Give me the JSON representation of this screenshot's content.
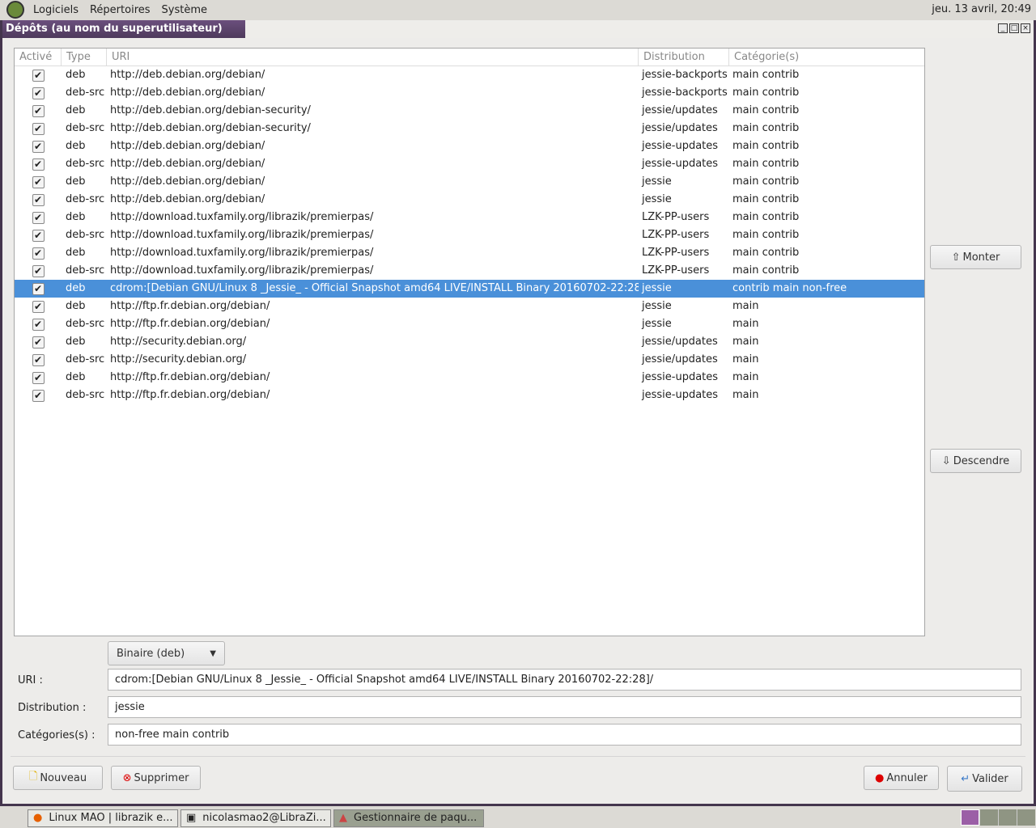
{
  "topbar": {
    "menus": [
      "Logiciels",
      "Répertoires",
      "Système"
    ],
    "clock": "jeu. 13 avril, 20:49"
  },
  "window": {
    "title": "Dépôts (au nom du superutilisateur)"
  },
  "table": {
    "headers": [
      "Activé",
      "Type",
      "URI",
      "Distribution",
      "Catégorie(s)"
    ],
    "rows": [
      [
        "deb",
        "http://deb.debian.org/debian/",
        "jessie-backports",
        "main contrib"
      ],
      [
        "deb-src",
        "http://deb.debian.org/debian/",
        "jessie-backports",
        "main contrib"
      ],
      [
        "deb",
        "http://deb.debian.org/debian-security/",
        "jessie/updates",
        "main contrib"
      ],
      [
        "deb-src",
        "http://deb.debian.org/debian-security/",
        "jessie/updates",
        "main contrib"
      ],
      [
        "deb",
        "http://deb.debian.org/debian/",
        "jessie-updates",
        "main contrib"
      ],
      [
        "deb-src",
        "http://deb.debian.org/debian/",
        "jessie-updates",
        "main contrib"
      ],
      [
        "deb",
        "http://deb.debian.org/debian/",
        "jessie",
        "main contrib"
      ],
      [
        "deb-src",
        "http://deb.debian.org/debian/",
        "jessie",
        "main contrib"
      ],
      [
        "deb",
        "http://download.tuxfamily.org/librazik/premierpas/",
        "LZK-PP-users",
        "main contrib"
      ],
      [
        "deb-src",
        "http://download.tuxfamily.org/librazik/premierpas/",
        "LZK-PP-users",
        "main contrib"
      ],
      [
        "deb",
        "http://download.tuxfamily.org/librazik/premierpas/",
        "LZK-PP-users",
        "main contrib"
      ],
      [
        "deb-src",
        "http://download.tuxfamily.org/librazik/premierpas/",
        "LZK-PP-users",
        "main contrib"
      ],
      [
        "deb",
        "cdrom:[Debian GNU/Linux 8 _Jessie_ - Official Snapshot amd64 LIVE/INSTALL Binary 20160702-22:28]/",
        "jessie",
        "contrib main non-free"
      ],
      [
        "deb",
        "http://ftp.fr.debian.org/debian/",
        "jessie",
        "main"
      ],
      [
        "deb-src",
        "http://ftp.fr.debian.org/debian/",
        "jessie",
        "main"
      ],
      [
        "deb",
        "http://security.debian.org/",
        "jessie/updates",
        "main"
      ],
      [
        "deb-src",
        "http://security.debian.org/",
        "jessie/updates",
        "main"
      ],
      [
        "deb",
        "http://ftp.fr.debian.org/debian/",
        "jessie-updates",
        "main"
      ],
      [
        "deb-src",
        "http://ftp.fr.debian.org/debian/",
        "jessie-updates",
        "main"
      ]
    ],
    "selected_index": 12
  },
  "side": {
    "up": "Monter",
    "down": "Descendre"
  },
  "form": {
    "type": "Binaire (deb)",
    "uri_label": "URI :",
    "uri": "cdrom:[Debian GNU/Linux 8 _Jessie_ - Official Snapshot amd64 LIVE/INSTALL Binary 20160702-22:28]/",
    "dist_label": "Distribution :",
    "dist": "jessie",
    "cat_label": "Catégories(s) :",
    "cat": "non-free main contrib"
  },
  "buttons": {
    "new": "Nouveau",
    "delete": "Supprimer",
    "cancel": "Annuler",
    "ok": "Valider"
  },
  "taskbar": {
    "tasks": [
      "Linux MAO | librazik e...",
      "nicolasmao2@LibraZi...",
      "Gestionnaire de paqu..."
    ]
  }
}
